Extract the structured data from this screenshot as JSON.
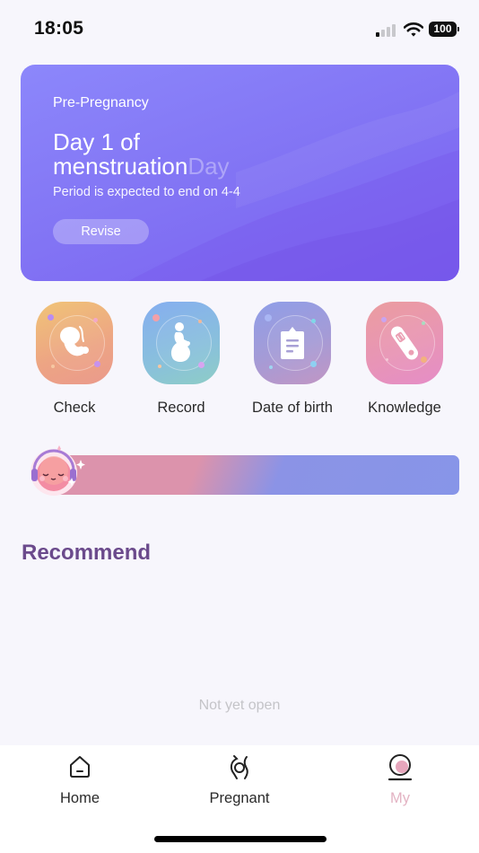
{
  "status_bar": {
    "time": "18:05",
    "battery": "100",
    "icons": [
      "cellular-signal-icon",
      "wifi-icon",
      "battery-icon"
    ]
  },
  "hero": {
    "label": "Pre-Pregnancy",
    "title_line1": "Day 1 of",
    "title_line2": "menstruation",
    "title_ghost": "Day",
    "subtitle": "Period is expected to end on 4-4",
    "revise_label": "Revise",
    "gradient_colors": [
      "#8c87fb",
      "#7a5ff0"
    ]
  },
  "tiles": [
    {
      "label": "Check",
      "icon": "fetus-icon",
      "colors": [
        "#f0c477",
        "#ea9a8c"
      ]
    },
    {
      "label": "Record",
      "icon": "pregnant-woman-icon",
      "colors": [
        "#86aef0",
        "#8ecdc6"
      ]
    },
    {
      "label": "Date of birth",
      "icon": "clipboard-icon",
      "colors": [
        "#8f9ee8",
        "#c196c4"
      ]
    },
    {
      "label": "Knowledge",
      "icon": "pregnancy-test-icon",
      "colors": [
        "#eb9d9f",
        "#e58dc7"
      ]
    }
  ],
  "banner": {
    "mascot": "headphones-mascot-icon",
    "colors": [
      "#dc93ac",
      "#8795e8"
    ]
  },
  "recommend": {
    "title": "Recommend",
    "empty_text": "Not yet open"
  },
  "bottom_nav": {
    "items": [
      {
        "label": "Home",
        "icon": "home-icon",
        "active": false
      },
      {
        "label": "Pregnant",
        "icon": "pregnant-icon",
        "active": false
      },
      {
        "label": "My",
        "icon": "profile-icon",
        "active": true
      }
    ],
    "active_color": "#e3b3c3"
  }
}
